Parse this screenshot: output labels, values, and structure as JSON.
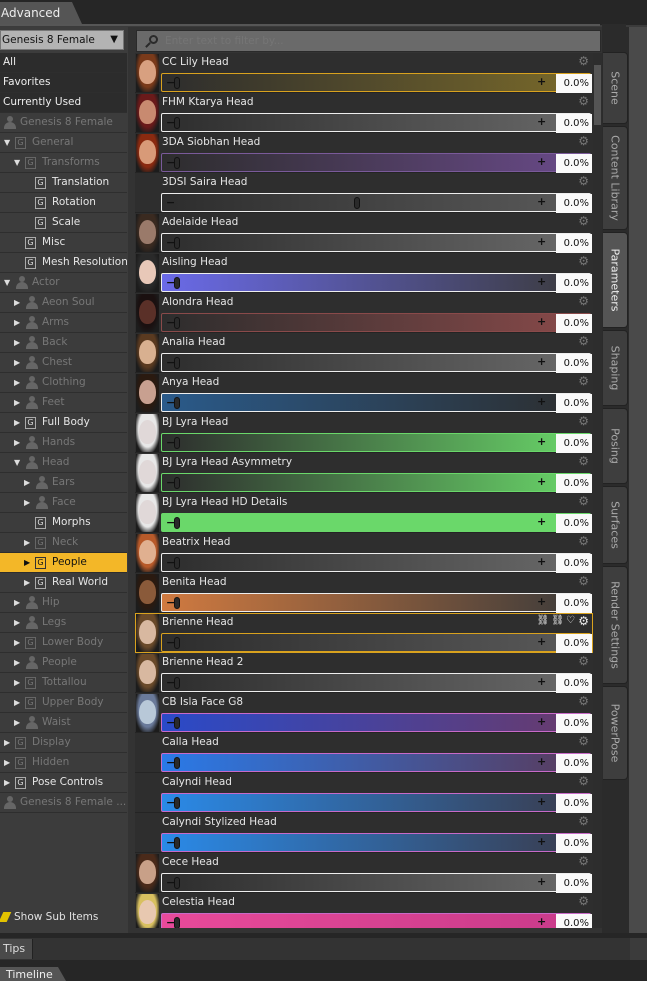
{
  "header": {
    "tab": "Advanced"
  },
  "left_panel": {
    "figure": "Genesis 8 Female",
    "tree": [
      {
        "label": "All",
        "indent": 0,
        "type": "top",
        "state": "normal"
      },
      {
        "label": "Favorites",
        "indent": 0,
        "type": "top",
        "state": "normal"
      },
      {
        "label": "Currently Used",
        "indent": 0,
        "type": "top",
        "state": "normal"
      },
      {
        "label": "Genesis 8 Female",
        "indent": 0,
        "type": "figure",
        "state": "dim",
        "twisty": ""
      },
      {
        "label": "General",
        "indent": 1,
        "type": "group",
        "state": "dim",
        "twisty": "down"
      },
      {
        "label": "Transforms",
        "indent": 2,
        "type": "group",
        "state": "dim",
        "twisty": "down"
      },
      {
        "label": "Translation",
        "indent": 3,
        "type": "group",
        "state": "normal",
        "twisty": ""
      },
      {
        "label": "Rotation",
        "indent": 3,
        "type": "group",
        "state": "normal",
        "twisty": ""
      },
      {
        "label": "Scale",
        "indent": 3,
        "type": "group",
        "state": "normal",
        "twisty": ""
      },
      {
        "label": "Misc",
        "indent": 2,
        "type": "group",
        "state": "normal",
        "twisty": ""
      },
      {
        "label": "Mesh Resolution",
        "indent": 2,
        "type": "group",
        "state": "normal",
        "twisty": ""
      },
      {
        "label": "Actor",
        "indent": 1,
        "type": "figure",
        "state": "dim",
        "twisty": "down"
      },
      {
        "label": "Aeon Soul",
        "indent": 2,
        "type": "figure",
        "state": "dim",
        "twisty": "right"
      },
      {
        "label": "Arms",
        "indent": 2,
        "type": "figure",
        "state": "dim",
        "twisty": "right"
      },
      {
        "label": "Back",
        "indent": 2,
        "type": "figure",
        "state": "dim",
        "twisty": "right"
      },
      {
        "label": "Chest",
        "indent": 2,
        "type": "figure",
        "state": "dim",
        "twisty": "right"
      },
      {
        "label": "Clothing",
        "indent": 2,
        "type": "figure",
        "state": "dim",
        "twisty": "right"
      },
      {
        "label": "Feet",
        "indent": 2,
        "type": "figure",
        "state": "dim",
        "twisty": "right"
      },
      {
        "label": "Full Body",
        "indent": 2,
        "type": "group",
        "state": "normal",
        "twisty": "right"
      },
      {
        "label": "Hands",
        "indent": 2,
        "type": "figure",
        "state": "dim",
        "twisty": "right"
      },
      {
        "label": "Head",
        "indent": 2,
        "type": "figure",
        "state": "dim",
        "twisty": "down"
      },
      {
        "label": "Ears",
        "indent": 3,
        "type": "figure",
        "state": "dim",
        "twisty": "right"
      },
      {
        "label": "Face",
        "indent": 3,
        "type": "figure",
        "state": "dim",
        "twisty": "right"
      },
      {
        "label": "Morphs",
        "indent": 3,
        "type": "group",
        "state": "normal",
        "twisty": ""
      },
      {
        "label": "Neck",
        "indent": 3,
        "type": "group",
        "state": "dim",
        "twisty": "right"
      },
      {
        "label": "People",
        "indent": 3,
        "type": "group",
        "state": "selected",
        "twisty": "right"
      },
      {
        "label": "Real World",
        "indent": 3,
        "type": "group",
        "state": "normal",
        "twisty": "right"
      },
      {
        "label": "Hip",
        "indent": 2,
        "type": "figure",
        "state": "dim",
        "twisty": "right"
      },
      {
        "label": "Legs",
        "indent": 2,
        "type": "figure",
        "state": "dim",
        "twisty": "right"
      },
      {
        "label": "Lower Body",
        "indent": 2,
        "type": "group",
        "state": "dim",
        "twisty": "right"
      },
      {
        "label": "People",
        "indent": 2,
        "type": "figure",
        "state": "dim",
        "twisty": "right"
      },
      {
        "label": "Tottallou",
        "indent": 2,
        "type": "group",
        "state": "dim",
        "twisty": "right"
      },
      {
        "label": "Upper Body",
        "indent": 2,
        "type": "group",
        "state": "dim",
        "twisty": "right"
      },
      {
        "label": "Waist",
        "indent": 2,
        "type": "figure",
        "state": "dim",
        "twisty": "right"
      },
      {
        "label": "Display",
        "indent": 1,
        "type": "group",
        "state": "dim",
        "twisty": "right"
      },
      {
        "label": "Hidden",
        "indent": 1,
        "type": "group",
        "state": "dim",
        "twisty": "right"
      },
      {
        "label": "Pose Controls",
        "indent": 1,
        "type": "group",
        "state": "normal",
        "twisty": "right"
      },
      {
        "label": "Genesis 8 Female ...",
        "indent": 0,
        "type": "figure",
        "state": "dim",
        "twisty": ""
      }
    ],
    "show_sub_items": "Show Sub Items"
  },
  "filter": {
    "placeholder": "Enter text to filter by..."
  },
  "params": [
    {
      "name": "CC Lily Head",
      "value": "0.0%",
      "knob": 0.0,
      "left": "#2d2d2d",
      "right": "#7a6a2a",
      "border": "#d9a21e",
      "skin": "#d8a080",
      "hair": "#7a3a1a"
    },
    {
      "name": "FHM Ktarya Head",
      "value": "0.0%",
      "knob": 0.0,
      "left": "#2d2d2d",
      "right": "#686868",
      "border": "#eeeeee",
      "skin": "#c88a70",
      "hair": "#6a1a1a"
    },
    {
      "name": "3DA Siobhan Head",
      "value": "0.0%",
      "knob": 0.0,
      "left": "#2d2d2d",
      "right": "#6a4a8a",
      "border": "#7a5a9a",
      "skin": "#d89a78",
      "hair": "#8a2a10"
    },
    {
      "name": "3DSI Saira Head",
      "value": "0.0%",
      "knob": 0.5,
      "left": "#2d2d2d",
      "right": "#5a5a5a",
      "border": "#eeeeee",
      "skin": "",
      "hair": ""
    },
    {
      "name": "Adelaide Head",
      "value": "0.0%",
      "knob": 0.0,
      "left": "#2d2d2d",
      "right": "#6a6a6a",
      "border": "#eeeeee",
      "skin": "#9a7a6a",
      "hair": "#3a2a20"
    },
    {
      "name": "Aisling Head",
      "value": "0.0%",
      "knob": 0.0,
      "left": "#6a6ae8",
      "right": "#3a3a3a",
      "border": "#eeeeee",
      "skin": "#e8c8b8",
      "hair": "#2a2a2a"
    },
    {
      "name": "Alondra Head",
      "value": "0.0%",
      "knob": 0.0,
      "left": "#2d2d2d",
      "right": "#8a4a4a",
      "border": "#8a4a4a",
      "skin": "#5a3028",
      "hair": "#1a1010"
    },
    {
      "name": "Analia Head",
      "value": "0.0%",
      "knob": 0.0,
      "left": "#2d2d2d",
      "right": "#6a6a6a",
      "border": "#eeeeee",
      "skin": "#d8b090",
      "hair": "#5a3a20"
    },
    {
      "name": "Anya Head",
      "value": "0.0%",
      "knob": 0.0,
      "left": "#2a5a8a",
      "right": "#2d2d2d",
      "border": "#eeeeee",
      "skin": "#c8a090",
      "hair": "#2a1a10"
    },
    {
      "name": "BJ Lyra Head",
      "value": "0.0%",
      "knob": 0.0,
      "left": "#2d2d2d",
      "right": "#6ad86a",
      "border": "#6ad86a",
      "skin": "#e0d8d8",
      "hair": "#e8e8e8"
    },
    {
      "name": "BJ Lyra Head Asymmetry",
      "value": "0.0%",
      "knob": 0.0,
      "left": "#2d2d2d",
      "right": "#6ad86a",
      "border": "#6ad86a",
      "skin": "#e0d8d8",
      "hair": "#e8e8e8"
    },
    {
      "name": "BJ Lyra Head HD Details",
      "value": "0.0%",
      "knob": 0.0,
      "left": "#6ad86a",
      "right": "#6ad86a",
      "border": "#6ad86a",
      "skin": "#e0d8d8",
      "hair": "#e8e8e8"
    },
    {
      "name": "Beatrix Head",
      "value": "0.0%",
      "knob": 0.0,
      "left": "#2d2d2d",
      "right": "#6a6a6a",
      "border": "#eeeeee",
      "skin": "#e0b090",
      "hair": "#b85a2a"
    },
    {
      "name": "Benita Head",
      "value": "0.0%",
      "knob": 0.0,
      "left": "#d07a40",
      "right": "#3a3a3a",
      "border": "#eeeeee",
      "skin": "#8a5a3a",
      "hair": "#2a1a10"
    },
    {
      "name": "Brienne Head",
      "value": "0.0%",
      "knob": 0.0,
      "left": "#2d2d2d",
      "right": "#5a5a5a",
      "border": "#d9a21e",
      "skin": "#d8b8a0",
      "hair": "#6a4a2a"
    },
    {
      "name": "Brienne Head 2",
      "value": "0.0%",
      "knob": 0.0,
      "left": "#2d2d2d",
      "right": "#6a6a6a",
      "border": "#eeeeee",
      "skin": "#d8b8a0",
      "hair": "#6a4a2a"
    },
    {
      "name": "CB Isla Face G8",
      "value": "0.0%",
      "knob": 0.0,
      "left": "#2a4ac8",
      "right": "#6a3a6a",
      "border": "#c86ac8",
      "skin": "#b8c8d8",
      "hair": "#6a7a9a"
    },
    {
      "name": "Calla Head",
      "value": "0.0%",
      "knob": 0.0,
      "left": "#2a7ae8",
      "right": "#5a3a5a",
      "border": "#c86ac8",
      "skin": "",
      "hair": ""
    },
    {
      "name": "Calyndi Head",
      "value": "0.0%",
      "knob": 0.0,
      "left": "#2a8ae8",
      "right": "#3a3a4a",
      "border": "#c86ac8",
      "skin": "",
      "hair": ""
    },
    {
      "name": "Calyndi Stylized Head",
      "value": "0.0%",
      "knob": 0.0,
      "left": "#2a8ae8",
      "right": "#3a3a4a",
      "border": "#c86ac8",
      "skin": "",
      "hair": ""
    },
    {
      "name": "Cece Head",
      "value": "0.0%",
      "knob": 0.0,
      "left": "#2d2d2d",
      "right": "#6a6a6a",
      "border": "#eeeeee",
      "skin": "#c8a088",
      "hair": "#4a2a1a"
    },
    {
      "name": "Celestia Head",
      "value": "0.0%",
      "knob": 0.0,
      "left": "#e84a9a",
      "right": "#c83a8a",
      "border": "#c86ac8",
      "skin": "#e8c8b0",
      "hair": "#d8c060"
    }
  ],
  "side_tabs": [
    {
      "label": "Scene",
      "active": false
    },
    {
      "label": "Content Library",
      "active": false
    },
    {
      "label": "Parameters",
      "active": true
    },
    {
      "label": "Shaping",
      "active": false
    },
    {
      "label": "Posing",
      "active": false
    },
    {
      "label": "Surfaces",
      "active": false
    },
    {
      "label": "Render Settings",
      "active": false
    },
    {
      "label": "PowerPose",
      "active": false
    }
  ],
  "bottom": {
    "tips": "Tips",
    "timeline": "Timeline"
  }
}
